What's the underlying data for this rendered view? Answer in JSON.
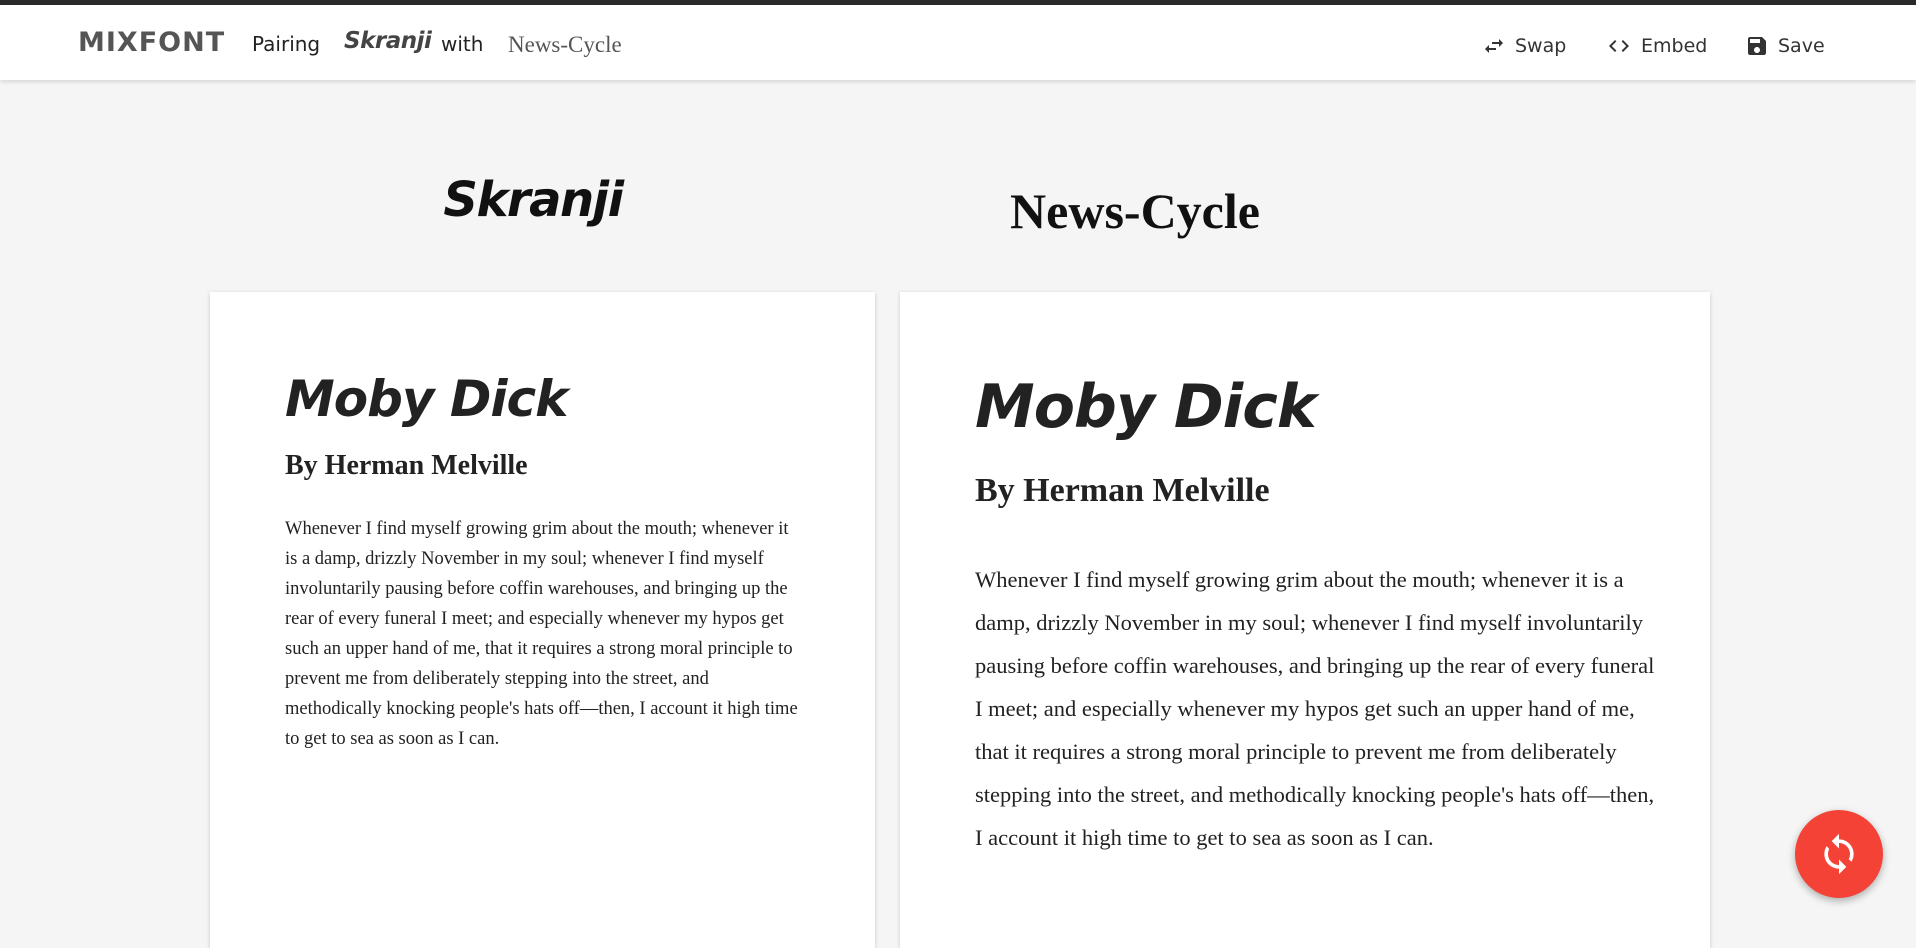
{
  "header": {
    "logo": "MIXFONT",
    "pairing_label": "Pairing",
    "font_a": "Skranji",
    "with_label": "with",
    "font_b": "News-Cycle",
    "actions": {
      "swap": "Swap",
      "embed": "Embed",
      "save": "Save"
    }
  },
  "columns": {
    "left_title": "Skranji",
    "right_title": "News-Cycle"
  },
  "preview": {
    "title": "Moby Dick",
    "author": "By Herman Melville",
    "body": "Whenever I find myself growing grim about the mouth; whenever it is a damp, drizzly November in my soul; whenever I find myself involuntarily pausing before coffin warehouses, and bringing up the rear of every funeral I meet; and especially whenever my hypos get such an upper hand of me, that it requires a strong moral principle to prevent me from deliberately stepping into the street, and methodically knocking people's hats off—then, I account it high time to get to sea as soon as I can."
  },
  "colors": {
    "accent_fab": "#f44336",
    "topline": "#2a2a2a",
    "background": "#f5f5f5"
  },
  "icons": {
    "swap": "swap-icon",
    "embed": "code-icon",
    "save": "floppy-disk-icon",
    "refresh": "refresh-icon"
  }
}
